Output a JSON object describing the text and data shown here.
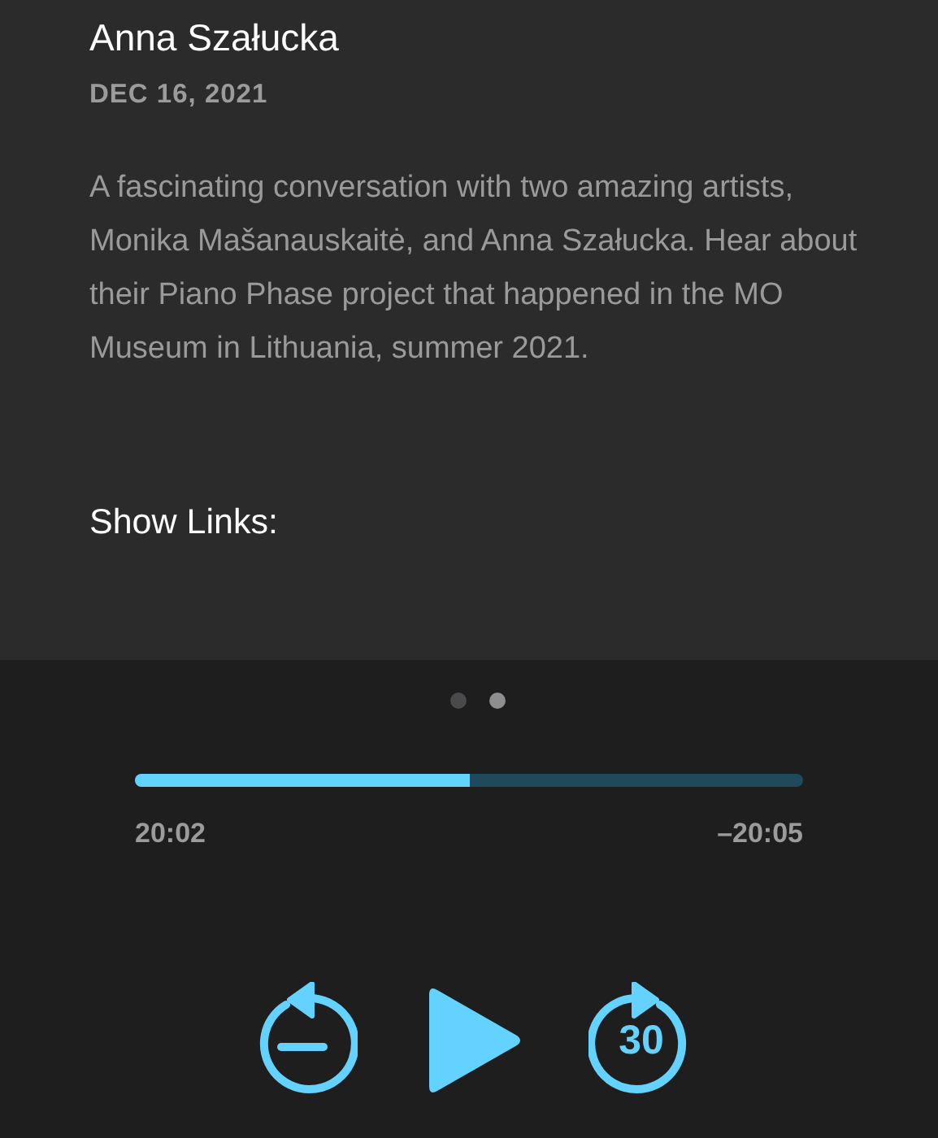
{
  "episode": {
    "title": "Anna Szałucka",
    "date": "DEC 16, 2021",
    "description": "A fascinating conversation with two amazing artists, Monika Mašanauskaitė, and Anna Szałucka. Hear about their Piano Phase project that happened in the MO Museum in Lithuania, summer 2021.",
    "links_heading": "Show Links:"
  },
  "player": {
    "pages": [
      {
        "selected": false
      },
      {
        "selected": true
      }
    ],
    "progress": {
      "level": 0.5
    },
    "elapsed": "20:02",
    "remaining": "–20:05",
    "controls": [
      {
        "kind": "rewind"
      },
      {
        "kind": "play"
      },
      {
        "kind": "forward",
        "label": "30"
      }
    ]
  }
}
